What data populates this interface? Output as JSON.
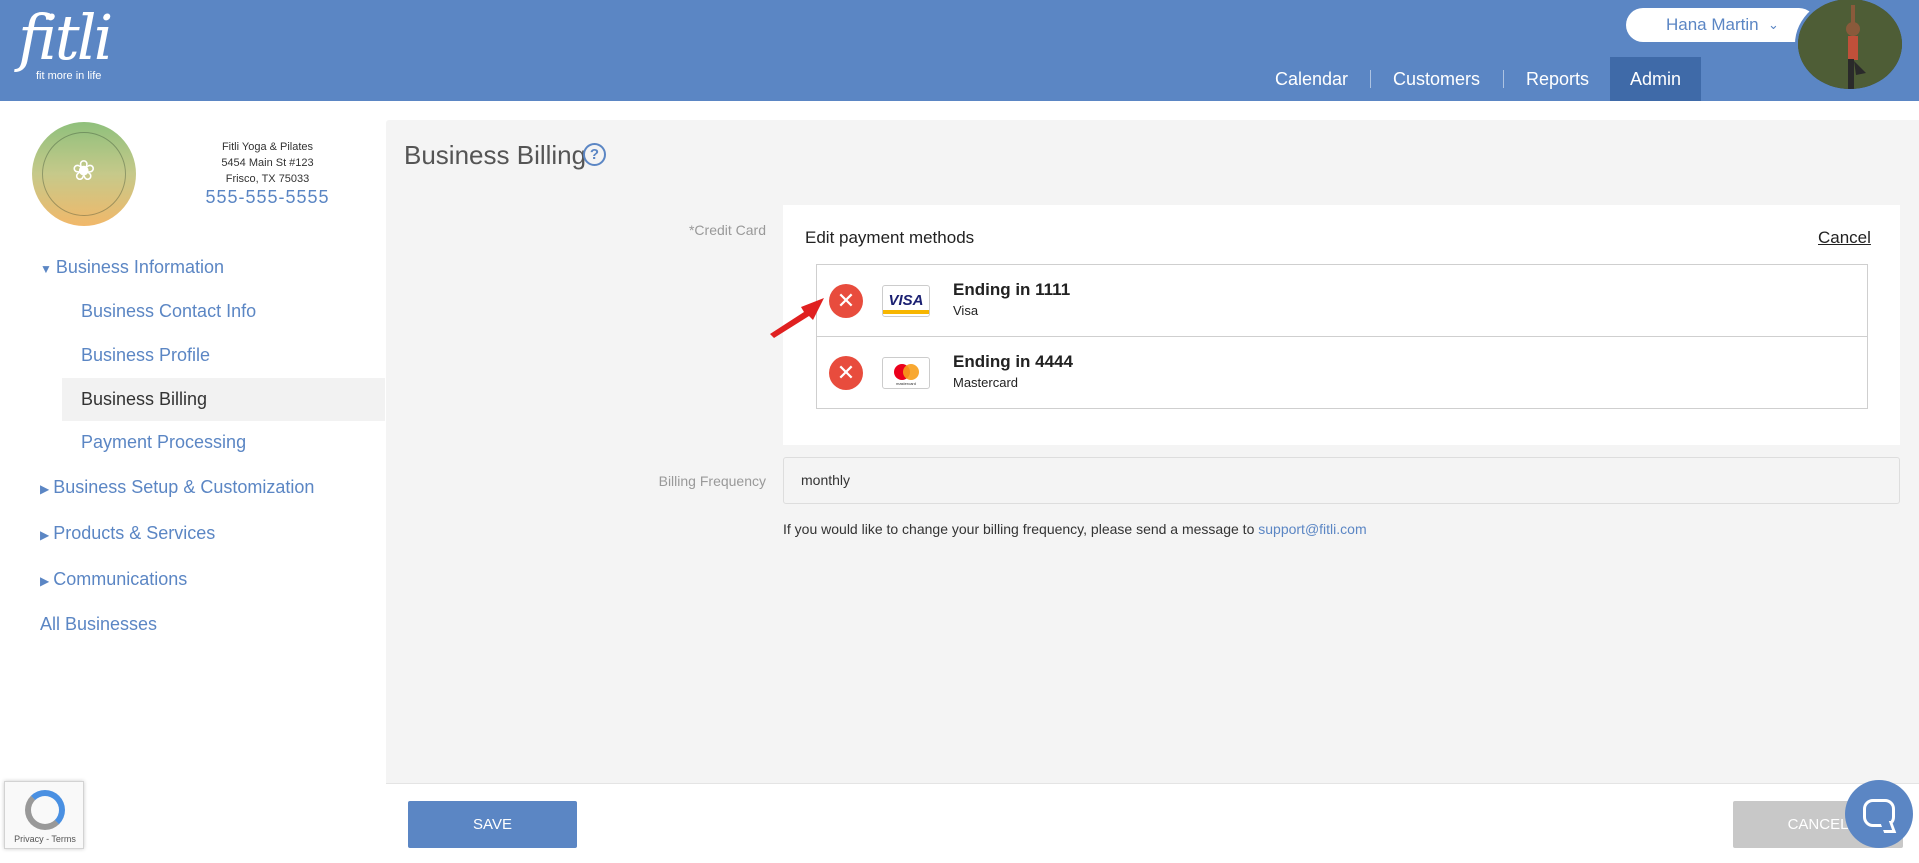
{
  "brand": {
    "logo_word": "fitli",
    "tagline": "fit more in life"
  },
  "header": {
    "user_name": "Hana Martin",
    "user_chevron": "⌄",
    "nav": [
      "Calendar",
      "Customers",
      "Reports",
      "Admin"
    ],
    "active_nav": "Admin",
    "accent": "#5b86c4"
  },
  "business": {
    "name": "Fitli Yoga & Pilates",
    "address1": "5454 Main St #123",
    "address2": "Frisco, TX 75033",
    "phone": "555-555-5555"
  },
  "sidebar": {
    "sections": [
      {
        "label": "Business Information",
        "expanded": true
      },
      {
        "label": "Business Setup & Customization",
        "expanded": false
      },
      {
        "label": "Products & Services",
        "expanded": false
      },
      {
        "label": "Communications",
        "expanded": false
      }
    ],
    "sub_items": [
      "Business Contact Info",
      "Business Profile",
      "Business Billing",
      "Payment Processing"
    ],
    "active_item": "Business Billing",
    "all_businesses": "All Businesses"
  },
  "page": {
    "title": "Business Billing",
    "help_icon": "?",
    "credit_card_label": "*Credit Card",
    "payment_methods": {
      "title": "Edit payment methods",
      "cancel_label": "Cancel",
      "cards": [
        {
          "ending": "Ending in 1111",
          "type": "Visa",
          "brand_icon": "visa-card-icon",
          "brand_text": "VISA"
        },
        {
          "ending": "Ending in 4444",
          "type": "Mastercard",
          "brand_icon": "mastercard-card-icon",
          "brand_text": "mastercard"
        }
      ],
      "delete_glyph": "✕"
    },
    "billing_frequency_label": "Billing Frequency",
    "billing_frequency_value": "monthly",
    "billing_note": "If you would like to change your billing frequency, please send a message to",
    "support_email": "support@fitli.com"
  },
  "footer": {
    "save_label": "SAVE",
    "cancel_label": "CANCEL"
  },
  "recaptcha": {
    "text": "Privacy - Terms"
  },
  "colors": {
    "delete": "#e84c3d",
    "arrow": "#e02020",
    "main_bg": "#f4f4f4"
  }
}
